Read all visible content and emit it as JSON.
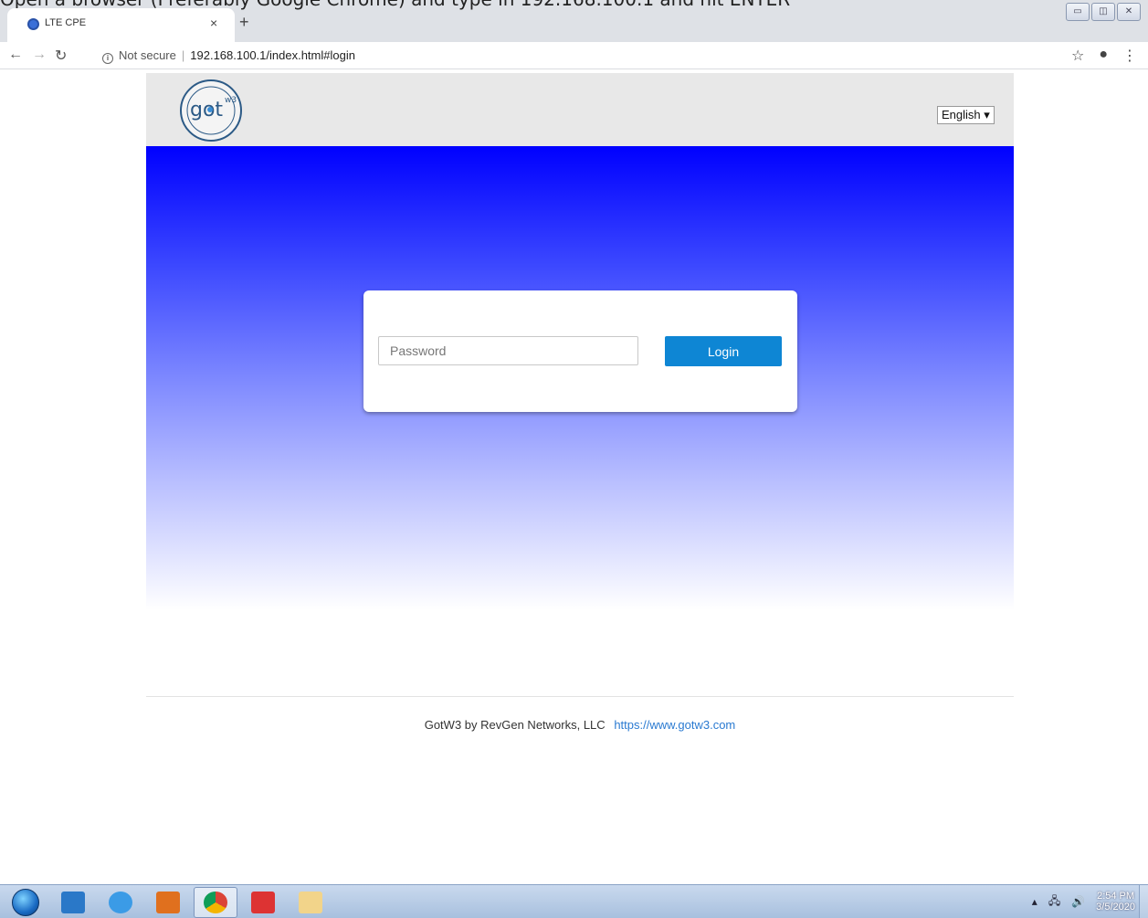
{
  "instruction": "Open a browser (Preferably Google Chrome) and type in 192.168.100.1 and hit ENTER",
  "browser": {
    "tab_title": "LTE CPE",
    "tab_close": "×",
    "new_tab": "+",
    "security_label": "Not secure",
    "url": "192.168.100.1/index.html#login"
  },
  "header": {
    "logo_text": "got",
    "logo_sup": "w3",
    "language": "English ▾"
  },
  "login": {
    "password_placeholder": "Password",
    "login_label": "Login"
  },
  "footer": {
    "text": "GotW3 by RevGen Networks, LLC",
    "link": "https://www.gotw3.com"
  },
  "taskbar": {
    "time": "2:54 PM",
    "date": "3/5/2020"
  }
}
